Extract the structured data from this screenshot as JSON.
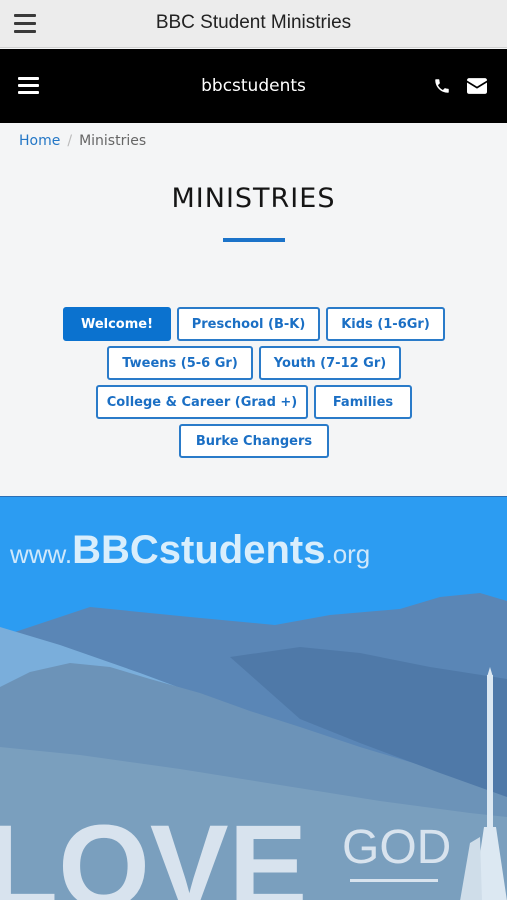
{
  "app": {
    "title": "BBC Student Ministries"
  },
  "site": {
    "brand": "bbcstudents"
  },
  "breadcrumb": {
    "home": "Home",
    "separator": "/",
    "current": "Ministries"
  },
  "page": {
    "title": "MINISTRIES"
  },
  "ministry_buttons": [
    {
      "label": "Welcome!",
      "active": true
    },
    {
      "label": "Preschool (B-K)"
    },
    {
      "label": "Kids (1-6Gr)"
    },
    {
      "label": "Tweens (5-6 Gr)"
    },
    {
      "label": "Youth (7-12 Gr)"
    },
    {
      "label": "College & Career (Grad +)"
    },
    {
      "label": "Families"
    },
    {
      "label": "Burke Changers"
    }
  ],
  "banner": {
    "url_prefix": "www.",
    "url_main": "BBCstudents",
    "url_suffix": ".org",
    "word_love": "LOVE",
    "word_god": "GOD"
  },
  "colors": {
    "accent": "#0b72cf",
    "header_bg": "#000000",
    "sky": "#2c9cf2"
  }
}
